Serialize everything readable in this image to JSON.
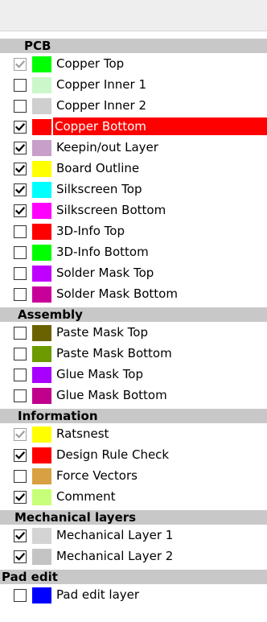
{
  "sections": [
    {
      "title": "PCB",
      "indent": 30,
      "items": [
        {
          "label": "Copper Top",
          "checked": true,
          "disabled": true,
          "color": "#00ff00",
          "selected": false
        },
        {
          "label": "Copper Inner 1",
          "checked": false,
          "disabled": false,
          "color": "#cbf7cb",
          "selected": false
        },
        {
          "label": "Copper Inner 2",
          "checked": false,
          "disabled": false,
          "color": "#cfcfcf",
          "selected": false
        },
        {
          "label": "Copper Bottom",
          "checked": true,
          "disabled": false,
          "color": "#ff0000",
          "selected": true
        },
        {
          "label": "Keepin/out Layer",
          "checked": true,
          "disabled": false,
          "color": "#c89fc8",
          "selected": false
        },
        {
          "label": "Board Outline",
          "checked": true,
          "disabled": false,
          "color": "#ffff00",
          "selected": false
        },
        {
          "label": "Silkscreen Top",
          "checked": true,
          "disabled": false,
          "color": "#00ffff",
          "selected": false
        },
        {
          "label": "Silkscreen Bottom",
          "checked": true,
          "disabled": false,
          "color": "#ff00ff",
          "selected": false
        },
        {
          "label": "3D-Info Top",
          "checked": false,
          "disabled": false,
          "color": "#ff0000",
          "selected": false
        },
        {
          "label": "3D-Info Bottom",
          "checked": false,
          "disabled": false,
          "color": "#00ff00",
          "selected": false
        },
        {
          "label": "Solder Mask Top",
          "checked": false,
          "disabled": false,
          "color": "#c000ff",
          "selected": false
        },
        {
          "label": "Solder Mask Bottom",
          "checked": false,
          "disabled": false,
          "color": "#c8009a",
          "selected": false
        }
      ]
    },
    {
      "title": "Assembly",
      "indent": 22,
      "items": [
        {
          "label": "Paste Mask Top",
          "checked": false,
          "disabled": false,
          "color": "#6a6200",
          "selected": false
        },
        {
          "label": "Paste Mask Bottom",
          "checked": false,
          "disabled": false,
          "color": "#6c9a00",
          "selected": false
        },
        {
          "label": "Glue Mask Top",
          "checked": false,
          "disabled": false,
          "color": "#a800ff",
          "selected": false
        },
        {
          "label": "Glue Mask Bottom",
          "checked": false,
          "disabled": false,
          "color": "#c0008c",
          "selected": false
        }
      ]
    },
    {
      "title": "Information",
      "indent": 22,
      "items": [
        {
          "label": "Ratsnest",
          "checked": true,
          "disabled": true,
          "color": "#ffff00",
          "selected": false
        },
        {
          "label": "Design Rule Check",
          "checked": true,
          "disabled": false,
          "color": "#ff0000",
          "selected": false
        },
        {
          "label": "Force Vectors",
          "checked": false,
          "disabled": false,
          "color": "#d8a040",
          "selected": false
        },
        {
          "label": "Comment",
          "checked": true,
          "disabled": false,
          "color": "#c8ff78",
          "selected": false
        }
      ]
    },
    {
      "title": "Mechanical layers",
      "indent": 18,
      "items": [
        {
          "label": "Mechanical Layer 1",
          "checked": true,
          "disabled": false,
          "color": "#d4d4d4",
          "selected": false
        },
        {
          "label": "Mechanical Layer 2",
          "checked": true,
          "disabled": false,
          "color": "#c4c4c4",
          "selected": false
        }
      ]
    },
    {
      "title": "Pad edit",
      "indent": 2,
      "items": [
        {
          "label": "Pad edit layer",
          "checked": false,
          "disabled": false,
          "color": "#0000ff",
          "selected": false
        }
      ]
    }
  ]
}
